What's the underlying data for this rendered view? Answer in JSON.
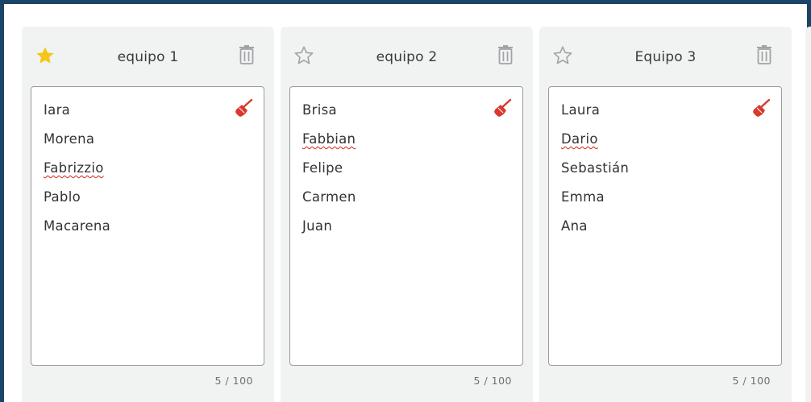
{
  "teams": [
    {
      "title": "equipo 1",
      "starred": true,
      "members": [
        {
          "name": "Iara",
          "misspelled": false
        },
        {
          "name": "Morena",
          "misspelled": false
        },
        {
          "name": "Fabrizzio",
          "misspelled": true
        },
        {
          "name": "Pablo",
          "misspelled": false
        },
        {
          "name": "Macarena",
          "misspelled": false
        }
      ],
      "counter": "5 / 100"
    },
    {
      "title": "equipo 2",
      "starred": false,
      "members": [
        {
          "name": "Brisa",
          "misspelled": false
        },
        {
          "name": "Fabbian",
          "misspelled": true
        },
        {
          "name": "Felipe",
          "misspelled": false
        },
        {
          "name": "Carmen",
          "misspelled": false
        },
        {
          "name": "Juan",
          "misspelled": false
        }
      ],
      "counter": "5 / 100"
    },
    {
      "title": "Equipo 3",
      "starred": false,
      "members": [
        {
          "name": "Laura",
          "misspelled": false
        },
        {
          "name": "Dario",
          "misspelled": true
        },
        {
          "name": "Sebastián",
          "misspelled": false
        },
        {
          "name": "Emma",
          "misspelled": false
        },
        {
          "name": "Ana",
          "misspelled": false
        }
      ],
      "counter": "5 / 100"
    }
  ],
  "icons": {
    "star_filled": "star-filled-icon",
    "star_outline": "star-outline-icon",
    "delete": "trash-icon",
    "clear": "broom-icon"
  },
  "colors": {
    "frame": "#1c4468",
    "card_bg": "#f1f3f2",
    "star_filled": "#f5c518",
    "icon_gray": "#a0a4a6",
    "broom_red": "#d83a2e",
    "spellcheck": "#d0241b"
  }
}
